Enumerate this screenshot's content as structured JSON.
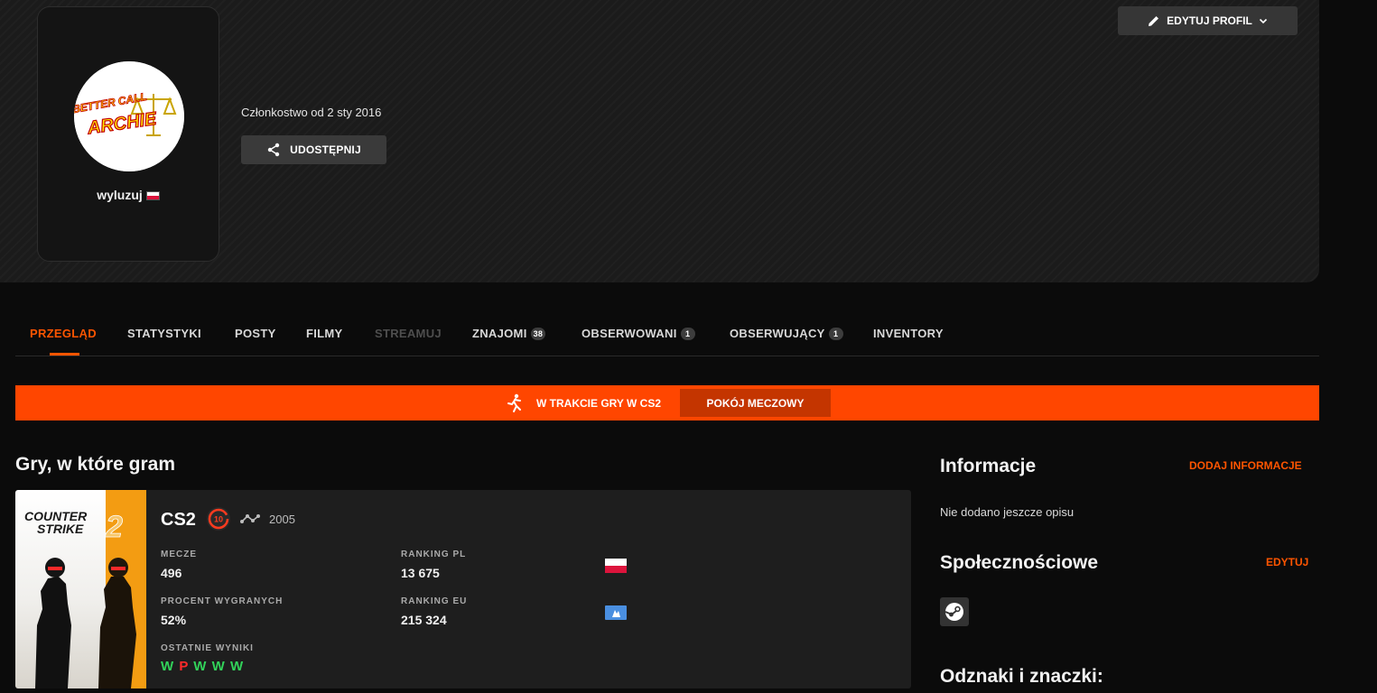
{
  "profile": {
    "nickname": "wyluzuj",
    "member_since": "Członkostwo od 2 sty 2016",
    "share_label": "UDOSTĘPNIJ",
    "edit_label": "EDYTUJ PROFIL",
    "avatar_top_text": "BETTER CALL",
    "avatar_main_text": "ARCHIE"
  },
  "tabs": [
    {
      "label": "PRZEGLĄD",
      "badge": ""
    },
    {
      "label": "STATYSTYKI",
      "badge": ""
    },
    {
      "label": "POSTY",
      "badge": ""
    },
    {
      "label": "FILMY",
      "badge": ""
    },
    {
      "label": "STREAMUJ",
      "badge": ""
    },
    {
      "label": "ZNAJOMI",
      "badge": "38"
    },
    {
      "label": "OBSERWOWANI",
      "badge": "1"
    },
    {
      "label": "OBSERWUJĄCY",
      "badge": "1"
    },
    {
      "label": "INVENTORY",
      "badge": ""
    }
  ],
  "live": {
    "status": "W TRAKCIE GRY W CS2",
    "room_button": "POKÓJ MECZOWY"
  },
  "games": {
    "title": "Gry, w które gram",
    "cover_line1": "COUNTER",
    "cover_line2": "STRIKE",
    "cover_number": "2",
    "name": "CS2",
    "level": "10",
    "elo": "2005",
    "stats": {
      "matches_label": "MECZE",
      "matches": "496",
      "winrate_label": "PROCENT WYGRANYCH",
      "winrate": "52%",
      "recent_label": "OSTATNIE WYNIKI",
      "recent": [
        "W",
        "P",
        "W",
        "W",
        "W"
      ],
      "ranking_pl_label": "RANKING PL",
      "ranking_pl": "13 675",
      "ranking_eu_label": "RANKING EU",
      "ranking_eu": "215 324"
    }
  },
  "info": {
    "title": "Informacje",
    "add_label": "DODAJ INFORMACJE",
    "empty_text": "Nie dodano jeszcze opisu",
    "social_title": "Społecznościowe",
    "social_edit": "EDYTUJ",
    "badges_title": "Odznaki i znaczki:"
  },
  "colors": {
    "accent": "#ff5500",
    "live_bar": "#ff4600",
    "win": "#32d35a",
    "loss": "#ff2a2a"
  },
  "icons": [
    "share-icon",
    "pencil-icon",
    "chevron-down-icon",
    "player-run-icon",
    "level-10-icon",
    "elo-chart-icon",
    "poland-flag-icon",
    "europe-region-icon",
    "steam-icon"
  ]
}
